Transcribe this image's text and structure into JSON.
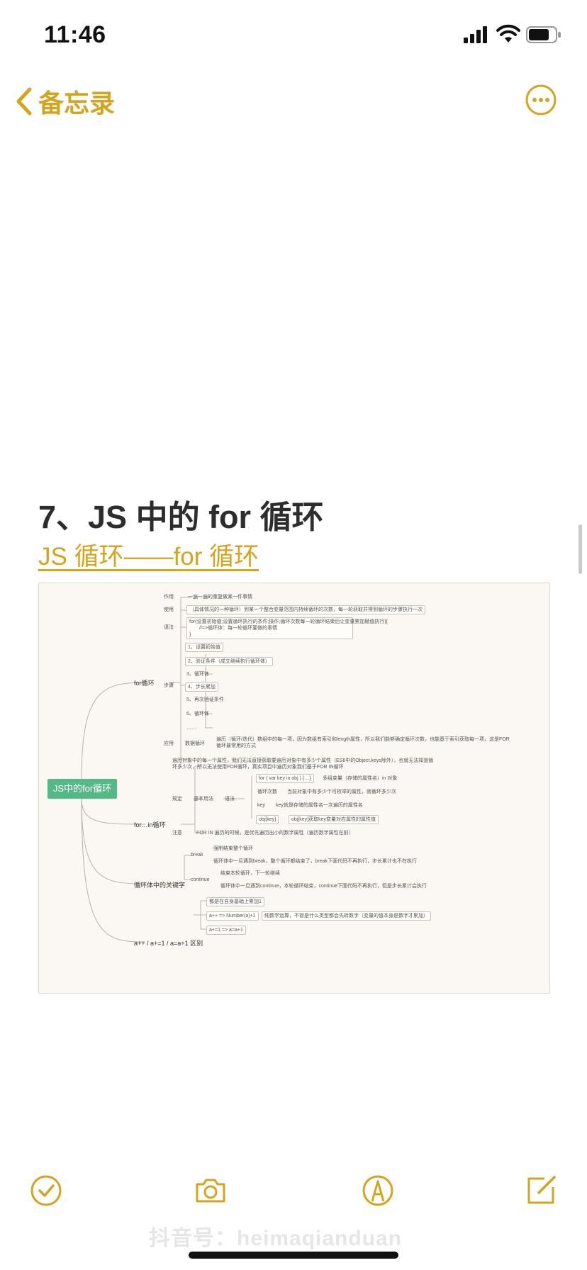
{
  "status_bar": {
    "time": "11:46"
  },
  "nav": {
    "back_label": "备忘录"
  },
  "note": {
    "title": "7、JS 中的 for 循环",
    "link_text": "JS 循环——for 循环"
  },
  "mindmap": {
    "root": "JS中的for循环",
    "branches": {
      "for_loop": "for循环",
      "for_in": "for…in循环",
      "keywords": "循环体中的关键字",
      "increment": "a++ / a+=1 / a=a+1 区别"
    },
    "for_loop": {
      "usage_label": "作用",
      "usage_text": "一遍一遍的重复做某一件事情",
      "use_label": "使用",
      "use_text": "（具体情况的一种循环）到某一个整合变量范围内持续循环的次数，每一轮获取并得到循环的步骤执行一次",
      "syntax_label": "语法",
      "syntax_line1": "for(设置初始值;设置循环执行的条件;操作;循环次数每一轮循环结束后让变量累加赋值执行){",
      "syntax_line2": "//=>循环体：每一轮循环要做的事情",
      "syntax_line3": "}",
      "steps_label": "步骤",
      "steps": [
        "1、设置初始值",
        "2、验证条件（成立继续执行循环体）",
        "3、循环体",
        "4、步长累加",
        "5、再次验证条件",
        "6、循环体",
        "……"
      ],
      "apply_label": "应用",
      "apply_sub": "数据循环",
      "apply_text": "遍历（循环/迭代）数组中的每一项，因为数组有索引和length属性，所以我们能够确定循环次数，也能基于索引获取每一项，这是FOR循环最常用的方式"
    },
    "for_in": {
      "intro": "遍历对象中的每一个属性，我们无法直接获取要遍历对象中有多少个属性（ES6中的Object.keys除外），也就无法知道循环多少次，所以无法使用FOR循环，真实项目中遍历对象我们基于FOR IN循环",
      "use_label": "规定",
      "sub_label": "基本用法",
      "syntax_label": "语法",
      "syntax_text": "for ( var key in obj ) {…}",
      "syntax_note": "多组变量（存储的属性名）in 对象",
      "count_label": "循环次数",
      "count_text": "当前对象中有多少个可枚举的属性，就循环多少次",
      "key_label": "key",
      "key_text": "key就是存储的属性名一次遍历的属性名",
      "objkey_label": "obj[key]",
      "objkey_text": "obj[key]获取key变量对应属性的属性值",
      "note_label": "注意",
      "note_text": "FOR IN 遍历的时候，是优先遍历出小的数字属性（遍历数字属性在前）"
    },
    "keywords": {
      "break_label": "break",
      "break_line1": "强制结束整个循环",
      "break_line2": "循环体中一旦遇到break，整个循环都结束了，break下面代码不再执行，步长累计也不在执行",
      "continue_label": "continue",
      "continue_line1": "结束本轮循环，下一轮继续",
      "continue_line2": "循环体中一旦遇到continue，本轮循环结束，continue下面代码不再执行，但是步长累计会执行"
    },
    "increment": {
      "line1": "都是在自身基础上累加1",
      "line2": "a++ => Number(a)+1",
      "line2_note": "纯数学运算，不管是什么类型都会先转数字（变量的值本身是数字才累加）",
      "line3": "a+=1 => a=a+1"
    }
  },
  "watermark": "抖音号：heimaqianduan",
  "colors": {
    "accent": "#d4a41e",
    "root_node": "#55b887"
  }
}
